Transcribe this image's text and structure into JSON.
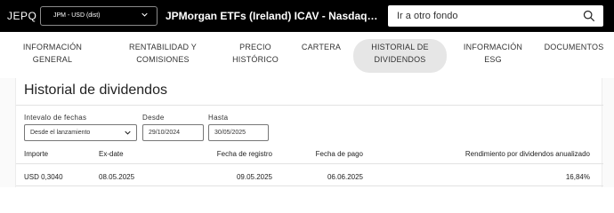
{
  "header": {
    "ticker": "JEPQ",
    "share_class": "JPM - USD (dist)",
    "fund_title": "JPMorgan ETFs (Ireland) ICAV - Nasdaq Equity Premiu...",
    "search_placeholder": "Ir a otro fondo"
  },
  "tabs": [
    {
      "line1": "Información",
      "line2": "general"
    },
    {
      "line1": "Rentabilidad y",
      "line2": "comisiones"
    },
    {
      "line1": "Precio",
      "line2": "histórico"
    },
    {
      "line1": "Cartera",
      "line2": ""
    },
    {
      "line1": "Historial de",
      "line2": "dividendos"
    },
    {
      "line1": "Información",
      "line2": "ESG"
    },
    {
      "line1": "Documentos",
      "line2": ""
    }
  ],
  "active_tab": 4,
  "section": {
    "title": "Historial de dividendos",
    "filters": {
      "interval_label": "Intevalo de fechas",
      "interval_value": "Desde el lanzamiento",
      "from_label": "Desde",
      "from_value": "29/10/2024",
      "to_label": "Hasta",
      "to_value": "30/05/2025"
    },
    "table": {
      "headers": [
        "Importe",
        "Ex-date",
        "Fecha de registro",
        "Fecha de pago",
        "Rendimiento por dividendos anualizado"
      ],
      "rows": [
        [
          "USD 0,3040",
          "08.05.2025",
          "09.05.2025",
          "06.06.2025",
          "16,84%"
        ]
      ]
    }
  }
}
